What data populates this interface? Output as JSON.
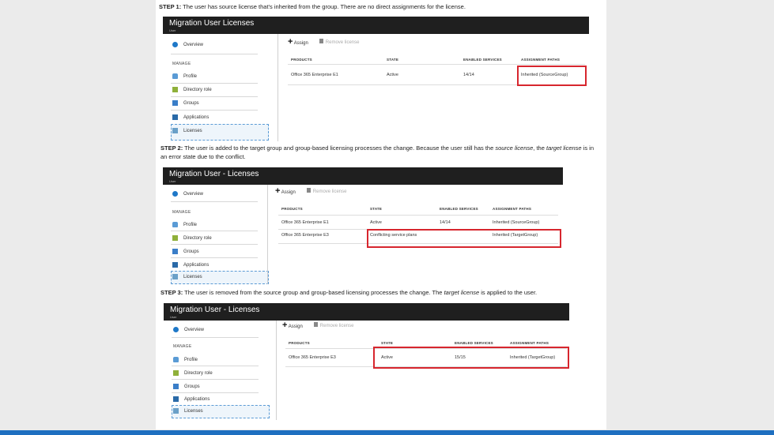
{
  "colors": {
    "header": "#1f1f1f",
    "highlight": "#d7262e",
    "accent": "#1e6fc0"
  },
  "step1": {
    "label": "STEP 1:",
    "text": " The user has source license that's inherited from the group. There are no direct assignments for the license.",
    "header_title": "Migration User   Licenses",
    "header_sub": "User"
  },
  "step2": {
    "label": "STEP 2:",
    "text_a": " The user is added to the target group and group-based licensing processes the change. Because the user still has the ",
    "em1": "source license",
    "text_b": ", the ",
    "em2": "target license",
    "text_c": " is in an error state due to the conflict.",
    "header_title": "Migration User - Licenses",
    "header_sub": "User"
  },
  "step3": {
    "label": "STEP 3:",
    "text_a": " The user is removed from the source group and group-based licensing processes the change. The ",
    "em1": "target license",
    "text_b": " is applied to the user.",
    "header_title": "Migration User - Licenses",
    "header_sub": "User"
  },
  "nav": {
    "overview": "Overview",
    "manage": "MANAGE",
    "profile": "Profile",
    "directory_role": "Directory role",
    "groups": "Groups",
    "applications": "Applications",
    "licenses": "Licenses"
  },
  "toolbar": {
    "assign": "Assign",
    "remove": "Remove license"
  },
  "columns": {
    "products": "PRODUCTS",
    "state": "STATE",
    "enabled": "ENABLED SERVICES",
    "paths": "ASSIGNMENT PATHS"
  },
  "table1": [
    {
      "product": "Office 365 Enterprise E1",
      "state": "Active",
      "enabled": "14/14",
      "path": "Inherited (SourceGroup)"
    }
  ],
  "table2": [
    {
      "product": "Office 365 Enterprise E1",
      "state": "Active",
      "enabled": "14/14",
      "path": "Inherited (SourceGroup)"
    },
    {
      "product": "Office 365 Enterprise E3",
      "state": "Conflicting service plans",
      "enabled": "",
      "path": "Inherited (TargetGroup)"
    }
  ],
  "table3": [
    {
      "product": "Office 365 Enterprise E3",
      "state": "Active",
      "enabled": "15/15",
      "path": "Inherited (TargetGroup)"
    }
  ]
}
